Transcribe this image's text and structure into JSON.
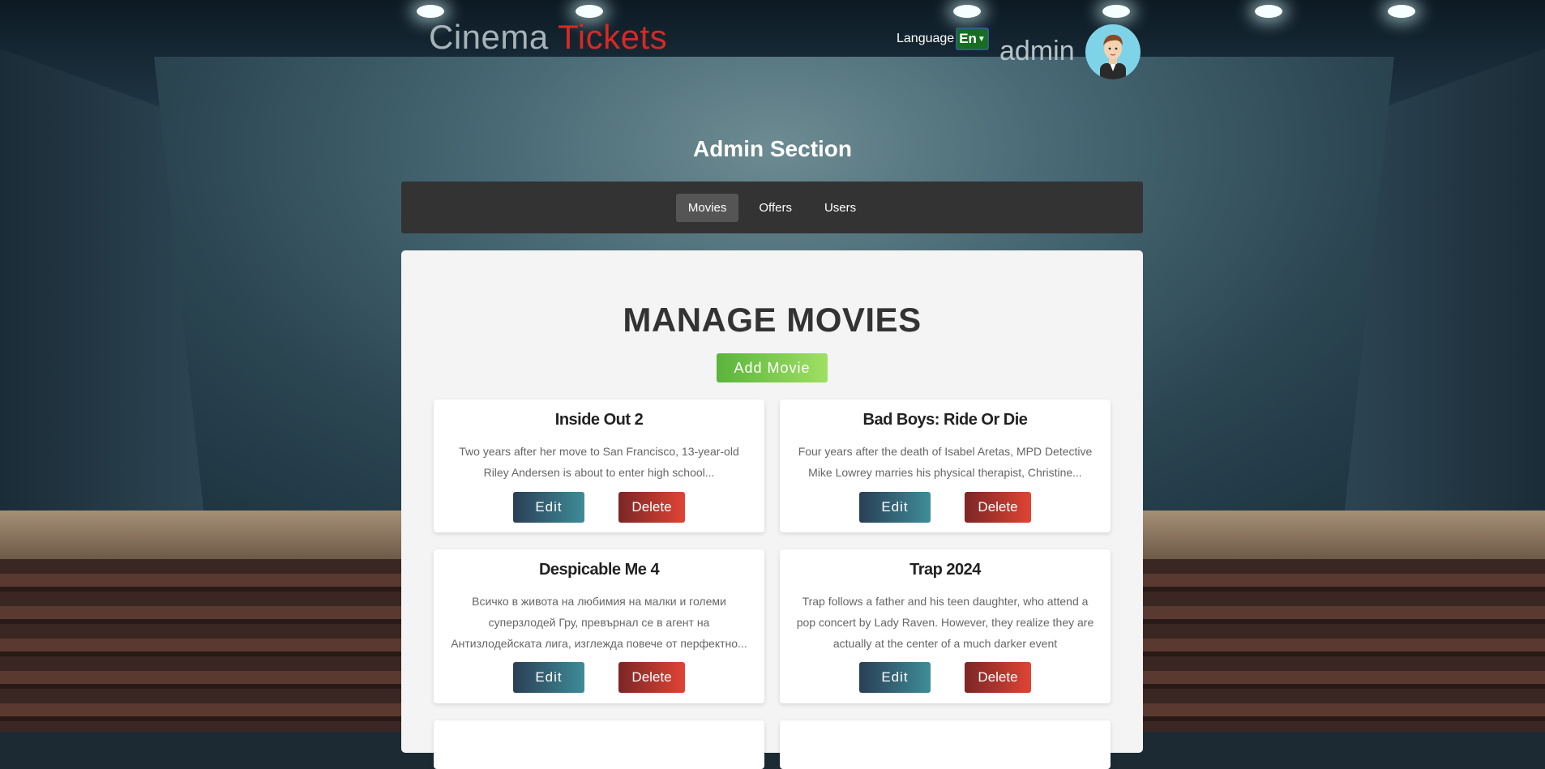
{
  "brand": {
    "word1": "Cinema",
    "word2": "Tickets"
  },
  "language": {
    "label": "Language",
    "selected": "En"
  },
  "user": {
    "name": "admin"
  },
  "section_title": "Admin Section",
  "tabs": [
    {
      "label": "Movies",
      "active": true
    },
    {
      "label": "Offers",
      "active": false
    },
    {
      "label": "Users",
      "active": false
    }
  ],
  "main": {
    "title": "MANAGE MOVIES",
    "add_button": "Add Movie",
    "edit_label": "Edit",
    "delete_label": "Delete",
    "movies": [
      {
        "title": "Inside Out 2",
        "description": "Two years after her move to San Francisco, 13-year-old Riley Andersen is about to enter high school..."
      },
      {
        "title": "Bad Boys: Ride Or Die",
        "description": "Four years after the death of Isabel Aretas, MPD Detective Mike Lowrey marries his physical therapist, Christine..."
      },
      {
        "title": "Despicable Me 4",
        "description": "Всичко в живота на любимия на малки и големи суперзлодей Гру, превърнал се в агент на Антизлодейската лига, изглежда повече от перфектно..."
      },
      {
        "title": "Trap 2024",
        "description": "Trap follows a father and his teen daughter, who attend a pop concert by Lady Raven. However, they realize they are actually at the center of a much darker event"
      }
    ]
  }
}
